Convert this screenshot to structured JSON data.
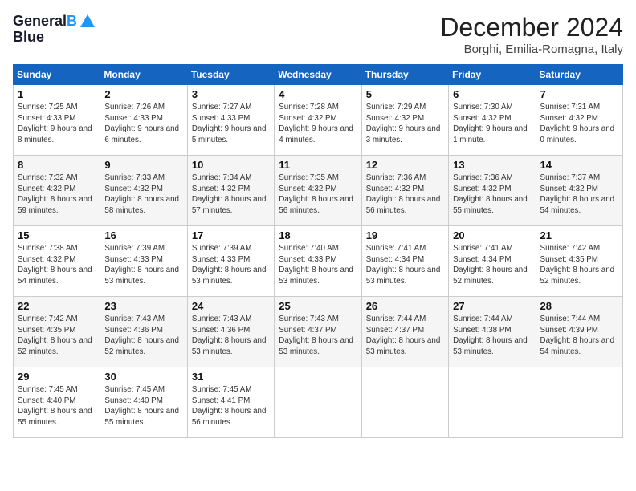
{
  "header": {
    "logo_line1": "General",
    "logo_line2": "Blue",
    "month": "December 2024",
    "location": "Borghi, Emilia-Romagna, Italy"
  },
  "weekdays": [
    "Sunday",
    "Monday",
    "Tuesday",
    "Wednesday",
    "Thursday",
    "Friday",
    "Saturday"
  ],
  "weeks": [
    [
      {
        "day": "1",
        "sunrise": "7:25 AM",
        "sunset": "4:33 PM",
        "daylight": "9 hours and 8 minutes."
      },
      {
        "day": "2",
        "sunrise": "7:26 AM",
        "sunset": "4:33 PM",
        "daylight": "9 hours and 6 minutes."
      },
      {
        "day": "3",
        "sunrise": "7:27 AM",
        "sunset": "4:33 PM",
        "daylight": "9 hours and 5 minutes."
      },
      {
        "day": "4",
        "sunrise": "7:28 AM",
        "sunset": "4:32 PM",
        "daylight": "9 hours and 4 minutes."
      },
      {
        "day": "5",
        "sunrise": "7:29 AM",
        "sunset": "4:32 PM",
        "daylight": "9 hours and 3 minutes."
      },
      {
        "day": "6",
        "sunrise": "7:30 AM",
        "sunset": "4:32 PM",
        "daylight": "9 hours and 1 minute."
      },
      {
        "day": "7",
        "sunrise": "7:31 AM",
        "sunset": "4:32 PM",
        "daylight": "9 hours and 0 minutes."
      }
    ],
    [
      {
        "day": "8",
        "sunrise": "7:32 AM",
        "sunset": "4:32 PM",
        "daylight": "8 hours and 59 minutes."
      },
      {
        "day": "9",
        "sunrise": "7:33 AM",
        "sunset": "4:32 PM",
        "daylight": "8 hours and 58 minutes."
      },
      {
        "day": "10",
        "sunrise": "7:34 AM",
        "sunset": "4:32 PM",
        "daylight": "8 hours and 57 minutes."
      },
      {
        "day": "11",
        "sunrise": "7:35 AM",
        "sunset": "4:32 PM",
        "daylight": "8 hours and 56 minutes."
      },
      {
        "day": "12",
        "sunrise": "7:36 AM",
        "sunset": "4:32 PM",
        "daylight": "8 hours and 56 minutes."
      },
      {
        "day": "13",
        "sunrise": "7:36 AM",
        "sunset": "4:32 PM",
        "daylight": "8 hours and 55 minutes."
      },
      {
        "day": "14",
        "sunrise": "7:37 AM",
        "sunset": "4:32 PM",
        "daylight": "8 hours and 54 minutes."
      }
    ],
    [
      {
        "day": "15",
        "sunrise": "7:38 AM",
        "sunset": "4:32 PM",
        "daylight": "8 hours and 54 minutes."
      },
      {
        "day": "16",
        "sunrise": "7:39 AM",
        "sunset": "4:33 PM",
        "daylight": "8 hours and 53 minutes."
      },
      {
        "day": "17",
        "sunrise": "7:39 AM",
        "sunset": "4:33 PM",
        "daylight": "8 hours and 53 minutes."
      },
      {
        "day": "18",
        "sunrise": "7:40 AM",
        "sunset": "4:33 PM",
        "daylight": "8 hours and 53 minutes."
      },
      {
        "day": "19",
        "sunrise": "7:41 AM",
        "sunset": "4:34 PM",
        "daylight": "8 hours and 53 minutes."
      },
      {
        "day": "20",
        "sunrise": "7:41 AM",
        "sunset": "4:34 PM",
        "daylight": "8 hours and 52 minutes."
      },
      {
        "day": "21",
        "sunrise": "7:42 AM",
        "sunset": "4:35 PM",
        "daylight": "8 hours and 52 minutes."
      }
    ],
    [
      {
        "day": "22",
        "sunrise": "7:42 AM",
        "sunset": "4:35 PM",
        "daylight": "8 hours and 52 minutes."
      },
      {
        "day": "23",
        "sunrise": "7:43 AM",
        "sunset": "4:36 PM",
        "daylight": "8 hours and 52 minutes."
      },
      {
        "day": "24",
        "sunrise": "7:43 AM",
        "sunset": "4:36 PM",
        "daylight": "8 hours and 53 minutes."
      },
      {
        "day": "25",
        "sunrise": "7:43 AM",
        "sunset": "4:37 PM",
        "daylight": "8 hours and 53 minutes."
      },
      {
        "day": "26",
        "sunrise": "7:44 AM",
        "sunset": "4:37 PM",
        "daylight": "8 hours and 53 minutes."
      },
      {
        "day": "27",
        "sunrise": "7:44 AM",
        "sunset": "4:38 PM",
        "daylight": "8 hours and 53 minutes."
      },
      {
        "day": "28",
        "sunrise": "7:44 AM",
        "sunset": "4:39 PM",
        "daylight": "8 hours and 54 minutes."
      }
    ],
    [
      {
        "day": "29",
        "sunrise": "7:45 AM",
        "sunset": "4:40 PM",
        "daylight": "8 hours and 55 minutes."
      },
      {
        "day": "30",
        "sunrise": "7:45 AM",
        "sunset": "4:40 PM",
        "daylight": "8 hours and 55 minutes."
      },
      {
        "day": "31",
        "sunrise": "7:45 AM",
        "sunset": "4:41 PM",
        "daylight": "8 hours and 56 minutes."
      },
      null,
      null,
      null,
      null
    ]
  ],
  "labels": {
    "sunrise": "Sunrise:",
    "sunset": "Sunset:",
    "daylight": "Daylight:"
  }
}
